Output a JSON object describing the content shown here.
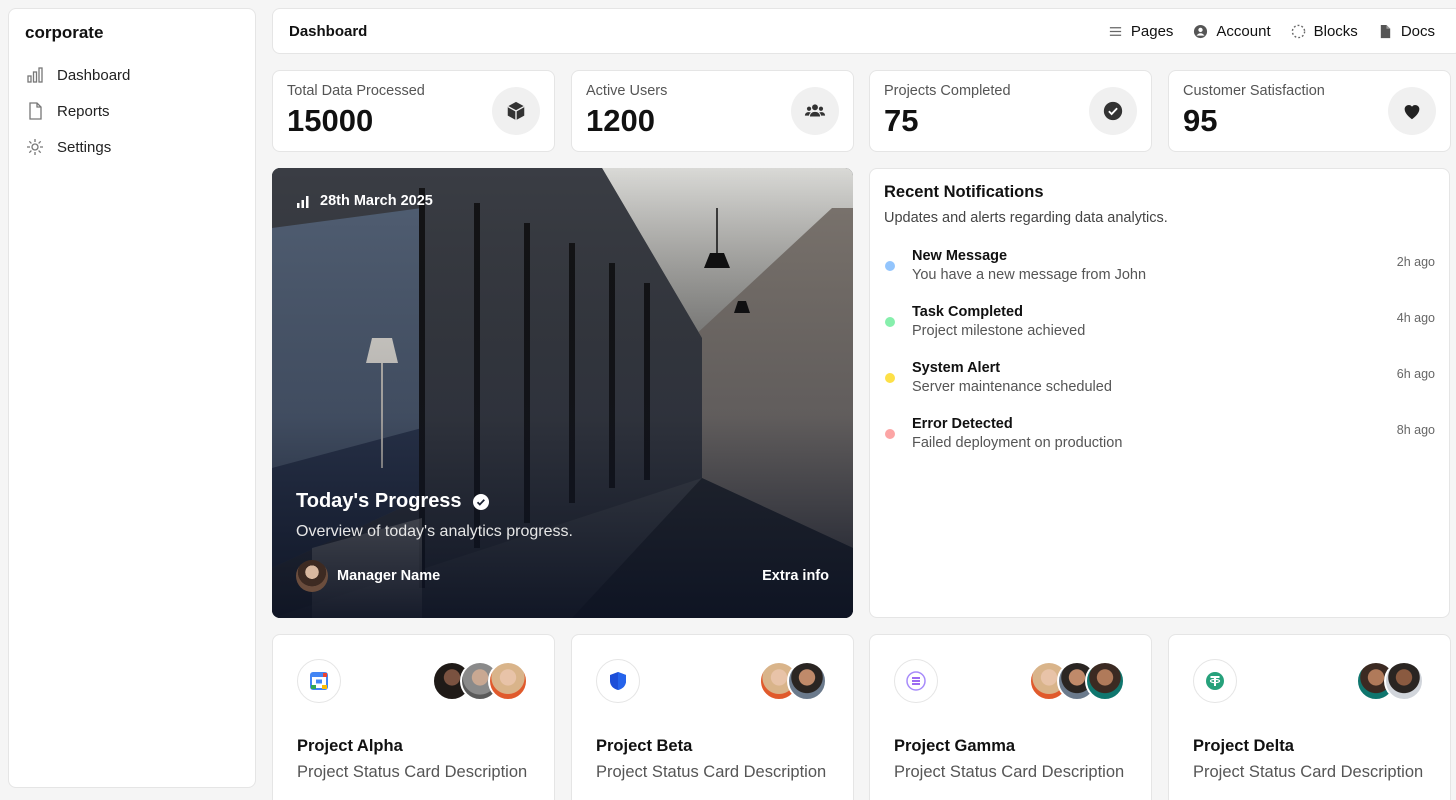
{
  "sidebar": {
    "brand": "corporate",
    "items": [
      {
        "label": "Dashboard",
        "icon": "bar-chart-icon"
      },
      {
        "label": "Reports",
        "icon": "file-icon"
      },
      {
        "label": "Settings",
        "icon": "gear-icon"
      }
    ]
  },
  "header": {
    "title": "Dashboard",
    "nav": [
      {
        "label": "Pages",
        "icon": "menu-icon"
      },
      {
        "label": "Account",
        "icon": "user-circle-icon"
      },
      {
        "label": "Blocks",
        "icon": "dotted-circle-icon"
      },
      {
        "label": "Docs",
        "icon": "document-icon"
      }
    ]
  },
  "stats": [
    {
      "label": "Total Data Processed",
      "value": "15000",
      "icon": "cube-icon"
    },
    {
      "label": "Active Users",
      "value": "1200",
      "icon": "users-icon"
    },
    {
      "label": "Projects Completed",
      "value": "75",
      "icon": "check-circle-icon"
    },
    {
      "label": "Customer Satisfaction",
      "value": "95",
      "icon": "heart-icon"
    }
  ],
  "hero": {
    "date": "28th March 2025",
    "title": "Today's Progress",
    "subtitle": "Overview of today's analytics progress.",
    "manager": "Manager Name",
    "extra": "Extra info"
  },
  "notifications": {
    "title": "Recent Notifications",
    "subtitle": "Updates and alerts regarding data analytics.",
    "items": [
      {
        "title": "New Message",
        "desc": "You have a new message from John",
        "time": "2h ago",
        "color": "#93c5fd"
      },
      {
        "title": "Task Completed",
        "desc": "Project milestone achieved",
        "time": "4h ago",
        "color": "#86efac"
      },
      {
        "title": "System Alert",
        "desc": "Server maintenance scheduled",
        "time": "6h ago",
        "color": "#fde047"
      },
      {
        "title": "Error Detected",
        "desc": "Failed deployment on production",
        "time": "8h ago",
        "color": "#fca5a5"
      }
    ]
  },
  "projects": [
    {
      "title": "Project Alpha",
      "desc": "Project Status Card Description",
      "logo": "google-calendar-icon"
    },
    {
      "title": "Project Beta",
      "desc": "Project Status Card Description",
      "logo": "shield-icon"
    },
    {
      "title": "Project Gamma",
      "desc": "Project Status Card Description",
      "logo": "solana-icon"
    },
    {
      "title": "Project Delta",
      "desc": "Project Status Card Description",
      "logo": "tether-icon"
    }
  ]
}
